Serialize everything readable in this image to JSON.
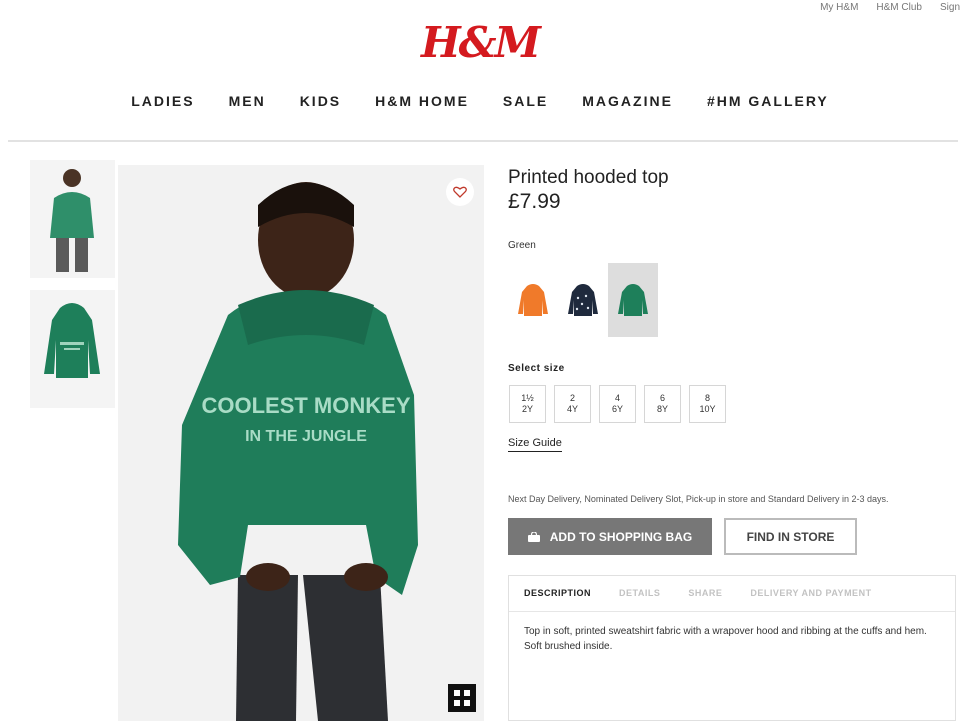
{
  "header": {
    "utility_links": [
      "My H&M",
      "H&M Club",
      "Sign"
    ],
    "logo": "H&M",
    "nav": [
      "LADIES",
      "MEN",
      "KIDS",
      "H&M HOME",
      "SALE",
      "MAGAZINE",
      "#HM GALLERY"
    ]
  },
  "product": {
    "title": "Printed hooded top",
    "price": "£7.99",
    "hoodie_print": [
      "COOLEST MONKEY",
      "IN THE JUNGLE"
    ],
    "color_label": "Green",
    "swatches": [
      {
        "name": "orange",
        "color": "#f07a2a"
      },
      {
        "name": "navy",
        "color": "#1f2a3d"
      },
      {
        "name": "green",
        "color": "#1e7f5a",
        "selected": true
      }
    ],
    "size_label": "Select size",
    "sizes": [
      {
        "top": "1½",
        "bottom": "2Y"
      },
      {
        "top": "2",
        "bottom": "4Y"
      },
      {
        "top": "4",
        "bottom": "6Y"
      },
      {
        "top": "6",
        "bottom": "8Y"
      },
      {
        "top": "8",
        "bottom": "10Y"
      }
    ],
    "size_guide": "Size Guide",
    "delivery_text": "Next Day Delivery, Nominated Delivery Slot, Pick-up in store and Standard Delivery in 2-3 days.",
    "add_to_bag": "ADD TO SHOPPING BAG",
    "find_in_store": "FIND IN STORE",
    "tabs": [
      "DESCRIPTION",
      "DETAILS",
      "SHARE",
      "DELIVERY AND PAYMENT"
    ],
    "description": "Top in soft, printed sweatshirt fabric with a wrapover hood and ribbing at the cuffs and hem. Soft brushed inside."
  },
  "colors": {
    "brand_red": "#d41a1f",
    "hoodie_green": "#1e7f5a",
    "button_grey": "#777777"
  },
  "icons": [
    "heart-icon",
    "zoom-icon",
    "bag-icon"
  ]
}
